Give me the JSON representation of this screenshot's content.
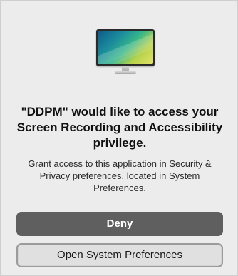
{
  "dialog": {
    "title": "\"DDPM\" would like to access your Screen Recording and Accessibility privilege.",
    "message": "Grant access to this application in Security & Privacy preferences, located in System Preferences.",
    "icon": "monitor-icon"
  },
  "buttons": {
    "deny_label": "Deny",
    "open_label": "Open System Preferences"
  },
  "colors": {
    "deny_bg": "#5f5f5f",
    "open_bg": "#e0e0e0",
    "dialog_bg": "#ececec"
  }
}
